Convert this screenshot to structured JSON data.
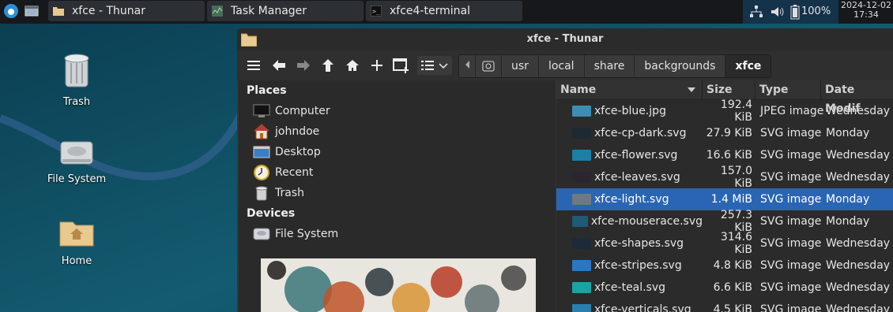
{
  "panel": {
    "tasks": [
      {
        "label": "xfce - Thunar",
        "icon": "folder-icon"
      },
      {
        "label": "Task Manager",
        "icon": "task-manager-icon"
      },
      {
        "label": "xfce4-terminal",
        "icon": "terminal-icon"
      }
    ],
    "battery": "100%",
    "clock_date": "2024-12-02",
    "clock_time": "17:34"
  },
  "desktop": {
    "icons": [
      {
        "label": "Trash",
        "icon": "trash-icon"
      },
      {
        "label": "File System",
        "icon": "drive-icon"
      },
      {
        "label": "Home",
        "icon": "home-folder-icon"
      }
    ]
  },
  "window": {
    "title": "xfce - Thunar",
    "breadcrumbs": [
      "usr",
      "local",
      "share",
      "backgrounds",
      "xfce"
    ]
  },
  "sidebar": {
    "places_label": "Places",
    "places": [
      {
        "label": "Computer",
        "icon": "computer-icon"
      },
      {
        "label": "johndoe",
        "icon": "home-icon"
      },
      {
        "label": "Desktop",
        "icon": "desktop-icon"
      },
      {
        "label": "Recent",
        "icon": "recent-icon"
      },
      {
        "label": "Trash",
        "icon": "trash-icon"
      }
    ],
    "devices_label": "Devices",
    "devices": [
      {
        "label": "File System",
        "icon": "drive-icon"
      }
    ]
  },
  "files": {
    "columns": [
      "Name",
      "Size",
      "Type",
      "Date Modif"
    ],
    "rows": [
      {
        "name": "xfce-blue.jpg",
        "size": "192.4 KiB",
        "type": "JPEG image",
        "date": "Wednesday",
        "thumb": "#3b8fb5"
      },
      {
        "name": "xfce-cp-dark.svg",
        "size": "27.9 KiB",
        "type": "SVG image",
        "date": "Monday",
        "thumb": "#1d2a33"
      },
      {
        "name": "xfce-flower.svg",
        "size": "16.6 KiB",
        "type": "SVG image",
        "date": "Wednesday",
        "thumb": "#1c7fa6"
      },
      {
        "name": "xfce-leaves.svg",
        "size": "157.0 KiB",
        "type": "SVG image",
        "date": "Wednesday",
        "thumb": "#2b2530"
      },
      {
        "name": "xfce-light.svg",
        "size": "1.4 MiB",
        "type": "SVG image",
        "date": "Monday",
        "thumb": "#6f7a80"
      },
      {
        "name": "xfce-mouserace.svg",
        "size": "257.3 KiB",
        "type": "SVG image",
        "date": "Monday",
        "thumb": "#1f5a77"
      },
      {
        "name": "xfce-shapes.svg",
        "size": "314.6 KiB",
        "type": "SVG image",
        "date": "Wednesday",
        "thumb": "#1e2a3a"
      },
      {
        "name": "xfce-stripes.svg",
        "size": "4.8 KiB",
        "type": "SVG image",
        "date": "Wednesday",
        "thumb": "#2a78c4"
      },
      {
        "name": "xfce-teal.svg",
        "size": "6.6 KiB",
        "type": "SVG image",
        "date": "Wednesday",
        "thumb": "#1aa3a3"
      },
      {
        "name": "xfce-verticals.svg",
        "size": "4.5 KiB",
        "type": "SVG image",
        "date": "Wednesday",
        "thumb": "#2b7fb0"
      }
    ],
    "selected_index": 4
  }
}
